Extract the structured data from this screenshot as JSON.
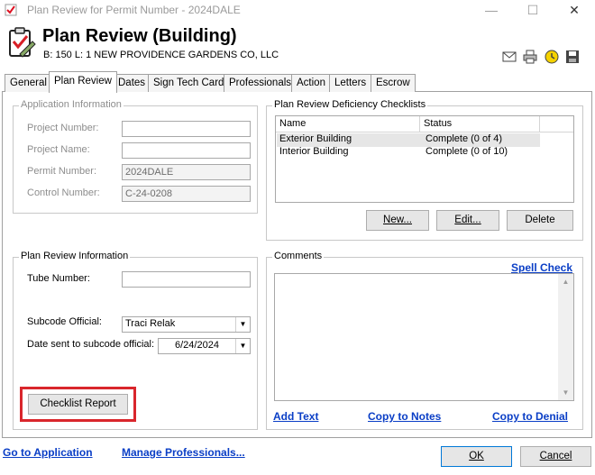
{
  "window": {
    "title": "Plan Review for Permit Number - 2024DALE",
    "minimize": "—",
    "maximize": "☐",
    "close": "✕"
  },
  "header": {
    "title": "Plan Review (Building)",
    "subtitle": "B: 150   L: 1  NEW PROVIDENCE GARDENS CO, LLC"
  },
  "tabs": [
    {
      "label": "General"
    },
    {
      "label": "Plan Review"
    },
    {
      "label": "Dates"
    },
    {
      "label": "Sign Tech Card"
    },
    {
      "label": "Professionals"
    },
    {
      "label": "Action"
    },
    {
      "label": "Letters"
    },
    {
      "label": "Escrow"
    }
  ],
  "active_tab": "Plan Review",
  "app_info": {
    "legend": "Application Information",
    "project_number_label": "Project Number:",
    "project_number_value": "",
    "project_name_label": "Project Name:",
    "project_name_value": "",
    "permit_number_label": "Permit Number:",
    "permit_number_value": "2024DALE",
    "control_number_label": "Control Number:",
    "control_number_value": "C-24-0208"
  },
  "deficiency": {
    "legend": "Plan Review Deficiency Checklists",
    "columns": [
      "Name",
      "Status"
    ],
    "rows": [
      {
        "name": "Exterior Building",
        "status": "Complete (0 of 4)"
      },
      {
        "name": "Interior Building",
        "status": "Complete (0 of 10)"
      }
    ],
    "new_label": "New...",
    "edit_label": "Edit...",
    "delete_label": "Delete"
  },
  "plan_review_info": {
    "legend": "Plan Review Information",
    "tube_number_label": "Tube Number:",
    "tube_number_value": "",
    "subcode_official_label": "Subcode Official:",
    "subcode_official_value": "Traci Relak",
    "date_sent_label": "Date sent to subcode official:",
    "date_sent_value": "6/24/2024",
    "checklist_report_label": "Checklist Report"
  },
  "comments": {
    "legend": "Comments",
    "spell_check": "Spell Check",
    "add_text": "Add Text",
    "copy_to_notes": "Copy to Notes",
    "copy_to_denial": "Copy to Denial"
  },
  "footer": {
    "go_to_application": "Go to Application",
    "manage_professionals": "Manage Professionals...",
    "ok_label": "OK",
    "cancel_label": "Cancel"
  },
  "colors": {
    "link": "#0a3ec6",
    "highlight": "#d9262c",
    "selected_row": "#e6e6e6"
  }
}
